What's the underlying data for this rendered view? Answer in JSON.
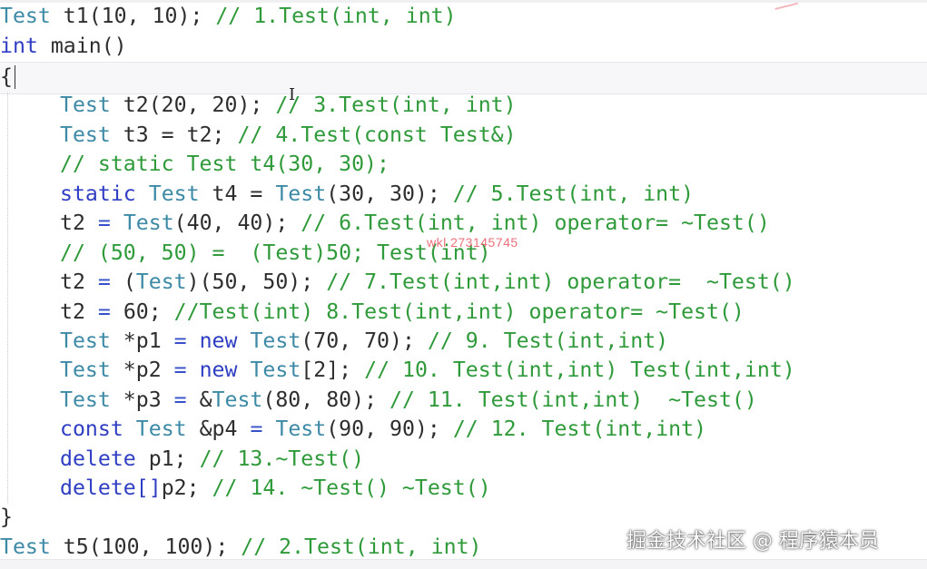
{
  "overlay": {
    "red_note": "wkl 273145745"
  },
  "watermark": "掘金技术社区 @ 程序猿本员",
  "code": {
    "line1": {
      "type": "Test",
      "rest": " t1(10, 10); ",
      "comment": "// 1.Test(int, int)"
    },
    "line2": {
      "kw": "int",
      "rest": " main()"
    },
    "line3": {
      "brace": "{"
    },
    "line4": {
      "type": "Test",
      "rest": " t2(20, 20); ",
      "comment": "// 3.Test(int, int)"
    },
    "line5": {
      "type": "Test",
      "rest": " t3 = t2; ",
      "comment": "// 4.Test(const Test&)"
    },
    "line6": {
      "comment": "// static Test t4(30, 30);"
    },
    "line7": {
      "kw": "static",
      "sp": " ",
      "type": "Test",
      "mid": " t4 = ",
      "type2": "Test",
      "rest": "(30, 30); ",
      "comment": "// 5.Test(int, int)"
    },
    "line8": {
      "pre": "t2 ",
      "op": "=",
      "sp": " ",
      "type": "Test",
      "rest": "(40, 40); ",
      "comment": "// 6.Test(int, int) operator= ~Test()"
    },
    "line9": {
      "comment": "// (50, 50) =  (Test)50; Test(int)"
    },
    "line10": {
      "pre": "t2 ",
      "op": "=",
      "mid": " (",
      "type": "Test",
      "rest": ")(50, 50); ",
      "comment": "// 7.Test(int,int) operator=  ~Test()"
    },
    "line11": {
      "pre": "t2 ",
      "op": "=",
      "rest": " 60; ",
      "comment": "//Test(int) 8.Test(int,int) operator= ~Test()"
    },
    "line12": {
      "type": "Test",
      "mid": " *p1 ",
      "op": "=",
      "sp": " ",
      "kw": "new",
      "sp2": " ",
      "type2": "Test",
      "rest": "(70, 70); ",
      "comment": "// 9. Test(int,int)"
    },
    "line13": {
      "type": "Test",
      "mid": " *p2 ",
      "op": "=",
      "sp": " ",
      "kw": "new",
      "sp2": " ",
      "type2": "Test",
      "rest": "[2]; ",
      "comment": "// 10. Test(int,int) Test(int,int)"
    },
    "line14": {
      "type": "Test",
      "mid": " *p3 ",
      "op": "=",
      "sp": " &",
      "type2": "Test",
      "rest": "(80, 80); ",
      "comment": "// 11. Test(int,int)  ~Test()"
    },
    "line15": {
      "kw": "const",
      "sp": " ",
      "type": "Test",
      "mid": " &p4 ",
      "op": "=",
      "sp2": " ",
      "type2": "Test",
      "rest": "(90, 90); ",
      "comment": "// 12. Test(int,int)"
    },
    "line16": {
      "kw": "delete",
      "rest": " p1; ",
      "comment": "// 13.~Test()"
    },
    "line17": {
      "kw": "delete[]",
      "rest": "p2; ",
      "comment": "// 14. ~Test() ~Test()"
    },
    "line18": {
      "brace": "}"
    },
    "line19": {
      "type": "Test",
      "rest": " t5(100, 100); ",
      "comment": "// 2.Test(int, int)"
    }
  },
  "colors": {
    "type": "#3d8aa6",
    "keyword": "#2f3ec2",
    "comment": "#2f9a3a",
    "text": "#2e2e2e",
    "annotation_red": "#e94b5b"
  }
}
